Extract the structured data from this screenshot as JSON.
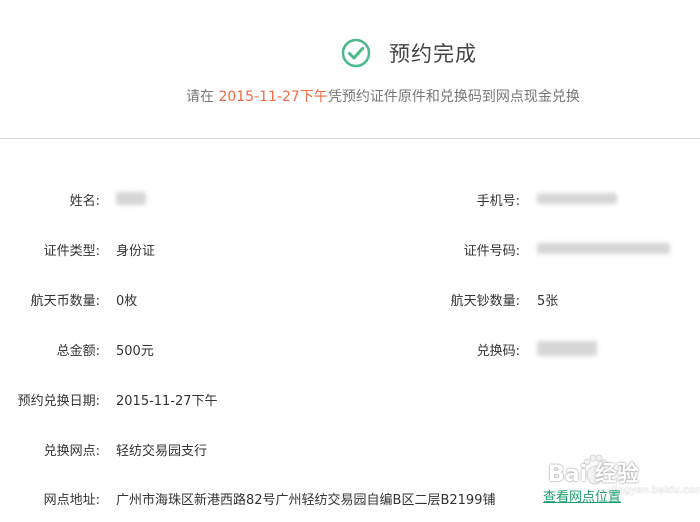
{
  "header": {
    "title": "预约完成",
    "subtitle_prefix": "请在",
    "subtitle_date": "2015-11-27下午",
    "subtitle_suffix": "凭预约证件原件和兑换码到网点现金兑换"
  },
  "fields": {
    "name_label": "姓名:",
    "phone_label": "手机号:",
    "id_type_label": "证件类型:",
    "id_type_value": "身份证",
    "id_number_label": "证件号码:",
    "coin_count_label": "航天币数量:",
    "coin_count_value": "0枚",
    "note_count_label": "航天钞数量:",
    "note_count_value": "5张",
    "total_label": "总金额:",
    "total_value": "500元",
    "code_label": "兑换码:",
    "date_label": "预约兑换日期:",
    "date_value": "2015-11-27下午",
    "branch_label": "兑换网点:",
    "branch_value": "轻纺交易园支行",
    "address_label": "网点地址:",
    "address_value": "广州市海珠区新港西路82号广州轻纺交易园自编B区二层B2199铺"
  },
  "actions": {
    "view_location_label": "查看网点位置"
  },
  "watermark": {
    "brand": "Bai 经验",
    "url": "jingyan.baidu.com"
  },
  "colors": {
    "success": "#4cb88a",
    "highlight": "#f06c45",
    "link": "#1f9f6b"
  }
}
